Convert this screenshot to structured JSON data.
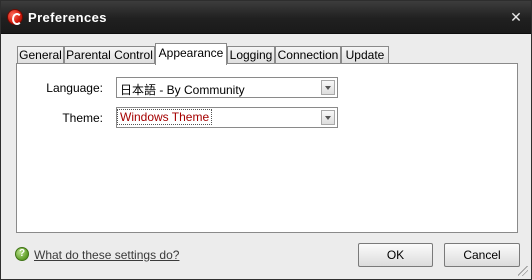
{
  "window": {
    "title": "Preferences",
    "close_glyph": "✕"
  },
  "tabs": [
    {
      "label": "General"
    },
    {
      "label": "Parental Control"
    },
    {
      "label": "Appearance",
      "active": true
    },
    {
      "label": "Logging"
    },
    {
      "label": "Connection"
    },
    {
      "label": "Update"
    }
  ],
  "form": {
    "language": {
      "label": "Language:",
      "value": "日本語 - By Community"
    },
    "theme": {
      "label": "Theme:",
      "value": "Windows Theme"
    }
  },
  "footer": {
    "help_link": "What do these settings do?",
    "ok_label": "OK",
    "cancel_label": "Cancel"
  },
  "icons": {
    "app": "comodo-logo-icon",
    "close": "close-icon",
    "help": "help-icon",
    "dropdown": "chevron-down-icon",
    "resize": "resize-grip-icon"
  },
  "colors": {
    "titlebar": "#202020",
    "theme_value_text": "#a50000"
  }
}
